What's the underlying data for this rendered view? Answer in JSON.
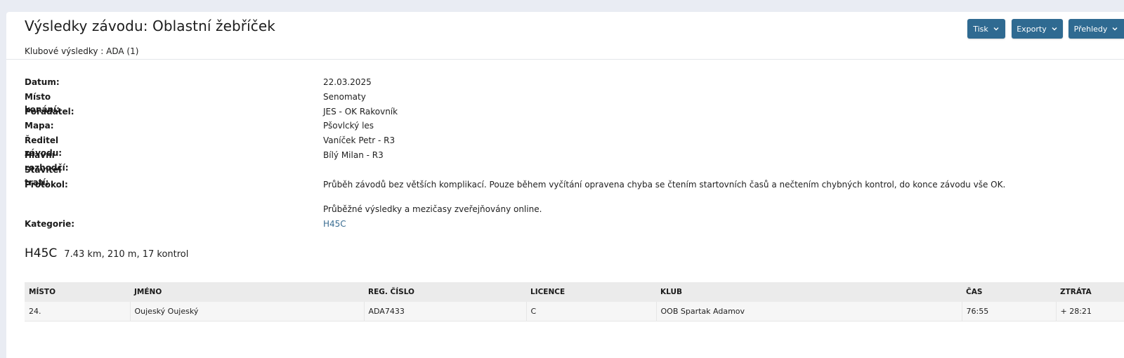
{
  "header": {
    "title": "Výsledky závodu: Oblastní žebříček",
    "subtitle": "Klubové výsledky : ADA (1)",
    "buttons": {
      "print": "Tisk",
      "exports": "Exporty",
      "overviews": "Přehledy"
    }
  },
  "info": {
    "date_label": "Datum:",
    "date_value": "22.03.2025",
    "venue_label": "Místo konání:",
    "venue_value": "Senomaty",
    "organizer_label": "Pořadatel:",
    "organizer_value": "JES - OK Rakovník",
    "map_label": "Mapa:",
    "map_value": "Pšovlcký les",
    "director_label": "Ředitel závodu:",
    "director_value": "Vaníček Petr - R3",
    "judge_label": "Hlavní rozhodčí:",
    "judge_value": "Bílý Milan - R3",
    "setter_label": "Stavitel tratí:",
    "setter_value": "",
    "protocol_label": "Protokol:",
    "protocol_p1": "Průběh závodů bez větších komplikací. Pouze během vyčítání opravena chyba se čtením startovních časů a nečtením chybných kontrol, do konce závodu vše OK.",
    "protocol_p2": "Průběžné výsledky a mezičasy zveřejňovány online.",
    "category_label": "Kategorie:",
    "category_value": "H45C"
  },
  "category": {
    "name": "H45C",
    "meta": "7.43 km, 210 m, 17 kontrol"
  },
  "table": {
    "columns": [
      "MÍSTO",
      "JMÉNO",
      "REG. ČÍSLO",
      "LICENCE",
      "KLUB",
      "ČAS",
      "ZTRÁTA"
    ],
    "rows": [
      [
        "24.",
        "Oujeský Oujeský",
        "ADA7433",
        "C",
        "OOB Spartak Adamov",
        "76:55",
        "+ 28:21"
      ]
    ]
  },
  "colors": {
    "background": "#e9ecf3",
    "button": "#2f6a91",
    "link": "#3a6d92"
  }
}
